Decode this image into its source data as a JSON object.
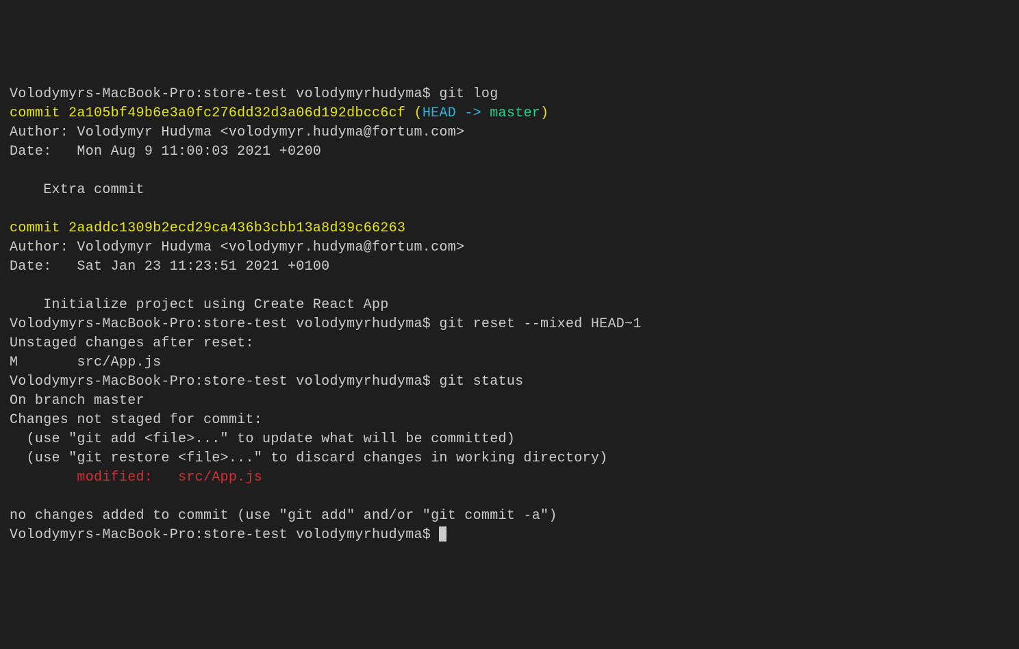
{
  "prompt": "Volodymyrs-MacBook-Pro:store-test volodymyrhudyma$ ",
  "cmd1": "git log",
  "commit1_label": "commit ",
  "commit1_hash": "2a105bf49b6e3a0fc276dd32d3a06d192dbcc6cf",
  "commit1_paren_open": " (",
  "commit1_head": "HEAD -> ",
  "commit1_branch": "master",
  "commit1_paren_close": ")",
  "commit1_author": "Author: Volodymyr Hudyma <volodymyr.hudyma@fortum.com>",
  "commit1_date": "Date:   Mon Aug 9 11:00:03 2021 +0200",
  "commit1_msg": "    Extra commit",
  "commit2_label": "commit ",
  "commit2_hash": "2aaddc1309b2ecd29ca436b3cbb13a8d39c66263",
  "commit2_author": "Author: Volodymyr Hudyma <volodymyr.hudyma@fortum.com>",
  "commit2_date": "Date:   Sat Jan 23 11:23:51 2021 +0100",
  "commit2_msg": "    Initialize project using Create React App",
  "cmd2": "git reset --mixed HEAD~1",
  "reset_out1": "Unstaged changes after reset:",
  "reset_out2": "M       src/App.js",
  "cmd3": "git status",
  "status_branch": "On branch master",
  "status_notstaged": "Changes not staged for commit:",
  "status_hint1": "  (use \"git add <file>...\" to update what will be committed)",
  "status_hint2": "  (use \"git restore <file>...\" to discard changes in working directory)",
  "status_modified": "        modified:   src/App.js",
  "status_nochanges": "no changes added to commit (use \"git add\" and/or \"git commit -a\")"
}
